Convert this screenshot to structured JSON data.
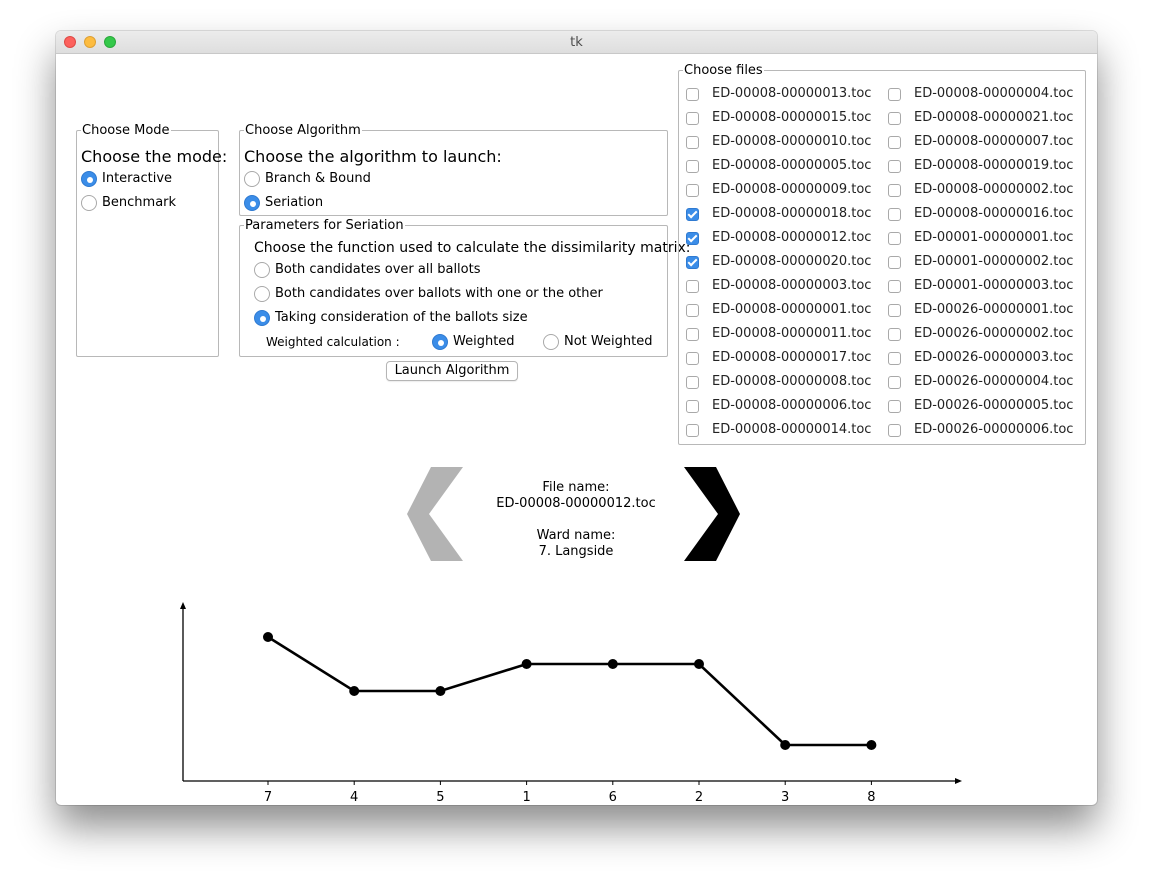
{
  "window": {
    "title": "tk"
  },
  "mode": {
    "legend": "Choose Mode",
    "heading": "Choose the mode:",
    "options": [
      {
        "label": "Interactive",
        "selected": true
      },
      {
        "label": "Benchmark",
        "selected": false
      }
    ]
  },
  "algorithm": {
    "legend": "Choose Algorithm",
    "heading": "Choose the algorithm to launch:",
    "options": [
      {
        "label": "Branch & Bound",
        "selected": false
      },
      {
        "label": "Seriation",
        "selected": true
      }
    ]
  },
  "parameters": {
    "legend": "Parameters for Seriation",
    "heading": "Choose the function used to calculate the dissimilarity matrix:",
    "options": [
      {
        "label": "Both candidates over all ballots",
        "selected": false
      },
      {
        "label": "Both candidates over ballots with one or the other",
        "selected": false
      },
      {
        "label": "Taking consideration of the ballots size",
        "selected": true
      }
    ],
    "weighted_label": "Weighted calculation :",
    "weighted_options": [
      {
        "label": "Weighted",
        "selected": true
      },
      {
        "label": "Not Weighted",
        "selected": false
      }
    ]
  },
  "launch_button": "Launch Algorithm",
  "files": {
    "legend": "Choose files",
    "left": [
      {
        "name": "ED-00008-00000013.toc",
        "checked": false
      },
      {
        "name": "ED-00008-00000015.toc",
        "checked": false
      },
      {
        "name": "ED-00008-00000010.toc",
        "checked": false
      },
      {
        "name": "ED-00008-00000005.toc",
        "checked": false
      },
      {
        "name": "ED-00008-00000009.toc",
        "checked": false
      },
      {
        "name": "ED-00008-00000018.toc",
        "checked": true
      },
      {
        "name": "ED-00008-00000012.toc",
        "checked": true
      },
      {
        "name": "ED-00008-00000020.toc",
        "checked": true
      },
      {
        "name": "ED-00008-00000003.toc",
        "checked": false
      },
      {
        "name": "ED-00008-00000001.toc",
        "checked": false
      },
      {
        "name": "ED-00008-00000011.toc",
        "checked": false
      },
      {
        "name": "ED-00008-00000017.toc",
        "checked": false
      },
      {
        "name": "ED-00008-00000008.toc",
        "checked": false
      },
      {
        "name": "ED-00008-00000006.toc",
        "checked": false
      },
      {
        "name": "ED-00008-00000014.toc",
        "checked": false
      }
    ],
    "right": [
      {
        "name": "ED-00008-00000004.toc",
        "checked": false
      },
      {
        "name": "ED-00008-00000021.toc",
        "checked": false
      },
      {
        "name": "ED-00008-00000007.toc",
        "checked": false
      },
      {
        "name": "ED-00008-00000019.toc",
        "checked": false
      },
      {
        "name": "ED-00008-00000002.toc",
        "checked": false
      },
      {
        "name": "ED-00008-00000016.toc",
        "checked": false
      },
      {
        "name": "ED-00001-00000001.toc",
        "checked": false
      },
      {
        "name": "ED-00001-00000002.toc",
        "checked": false
      },
      {
        "name": "ED-00001-00000003.toc",
        "checked": false
      },
      {
        "name": "ED-00026-00000001.toc",
        "checked": false
      },
      {
        "name": "ED-00026-00000002.toc",
        "checked": false
      },
      {
        "name": "ED-00026-00000003.toc",
        "checked": false
      },
      {
        "name": "ED-00026-00000004.toc",
        "checked": false
      },
      {
        "name": "ED-00026-00000005.toc",
        "checked": false
      },
      {
        "name": "ED-00026-00000006.toc",
        "checked": false
      }
    ]
  },
  "navigator": {
    "file_label": "File name:",
    "file_value": "ED-00008-00000012.toc",
    "ward_label": "Ward name:",
    "ward_value": "7. Langside",
    "prev_icon": "chevron-left-icon",
    "next_icon": "chevron-right-icon",
    "prev_color": "#b3b3b3",
    "next_color": "#000000"
  },
  "chart_data": {
    "type": "line",
    "categories": [
      "7",
      "4",
      "5",
      "1",
      "6",
      "2",
      "3",
      "8"
    ],
    "values": [
      4,
      2,
      2,
      3,
      3,
      3,
      0,
      0
    ],
    "title": "",
    "xlabel": "",
    "ylabel": "",
    "ylim": [
      -1,
      5
    ],
    "grid": false
  }
}
